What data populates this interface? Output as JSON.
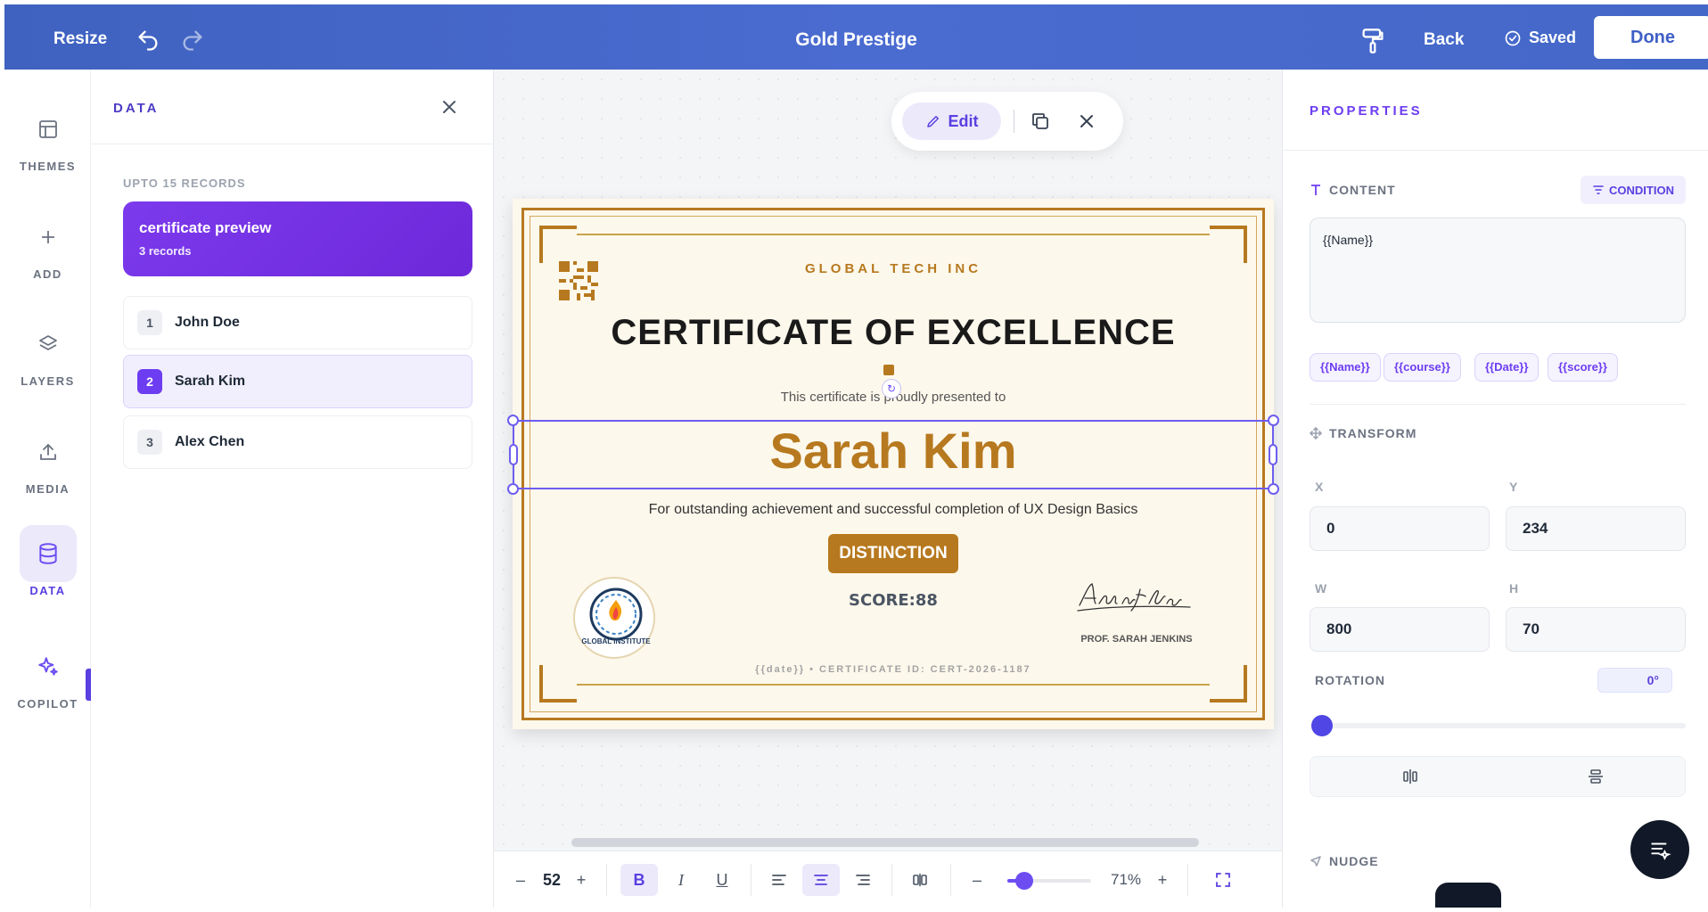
{
  "topbar": {
    "resize_label": "Resize",
    "title": "Gold Prestige",
    "back_label": "Back",
    "saved_label": "Saved",
    "done_label": "Done"
  },
  "rail": {
    "items": [
      {
        "label": "THEMES",
        "icon": "layout-icon"
      },
      {
        "label": "ADD",
        "icon": "plus-icon"
      },
      {
        "label": "LAYERS",
        "icon": "layers-icon"
      },
      {
        "label": "MEDIA",
        "icon": "upload-icon"
      },
      {
        "label": "DATA",
        "icon": "database-icon"
      },
      {
        "label": "COPILOT",
        "icon": "sparkle-icon"
      }
    ],
    "active": "DATA"
  },
  "data_panel": {
    "title": "DATA",
    "limit_label": "UPTO 15 RECORDS",
    "dataset": {
      "name": "certificate preview",
      "count": "3 records"
    },
    "records": [
      {
        "index": "1",
        "name": "John Doe"
      },
      {
        "index": "2",
        "name": "Sarah Kim"
      },
      {
        "index": "3",
        "name": "Alex Chen"
      }
    ],
    "selected_index": "2"
  },
  "floating_toolbar": {
    "edit_label": "Edit"
  },
  "certificate": {
    "organization": "GLOBAL TECH INC",
    "title": "CERTIFICATE OF EXCELLENCE",
    "presented_text": "This certificate is proudly presented to",
    "recipient": "Sarah Kim",
    "achievement": "For outstanding achievement and successful completion of UX Design Basics",
    "badge": "DISTINCTION",
    "seal_text": "GLOBAL INSTITUTE",
    "score": "SCORE:88",
    "signature": "Alexander J Sterling",
    "signer": "PROF. SARAH JENKINS",
    "footer": "{{date}}  •  CERTIFICATE ID: CERT-2026-1187"
  },
  "bottom_toolbar": {
    "font_size": "52",
    "bold": "B",
    "italic": "I",
    "underline": "U",
    "zoom": "71%",
    "zoom_fraction": 0.2
  },
  "properties": {
    "title": "PROPERTIES",
    "content_label": "CONTENT",
    "condition_label": "CONDITION",
    "content_value": "{{Name}}",
    "chips": [
      "{{Name}}",
      "{{course}}",
      "{{Date}}",
      "{{score}}"
    ],
    "transform_label": "TRANSFORM",
    "x_label": "X",
    "x_value": "0",
    "y_label": "Y",
    "y_value": "234",
    "w_label": "W",
    "w_value": "800",
    "h_label": "H",
    "h_value": "70",
    "rotation_label": "ROTATION",
    "rotation_value": "0°",
    "nudge_label": "NUDGE"
  },
  "colors": {
    "accent": "#6d3df2",
    "topbar": "#4468c8",
    "gold": "#b7791f"
  }
}
